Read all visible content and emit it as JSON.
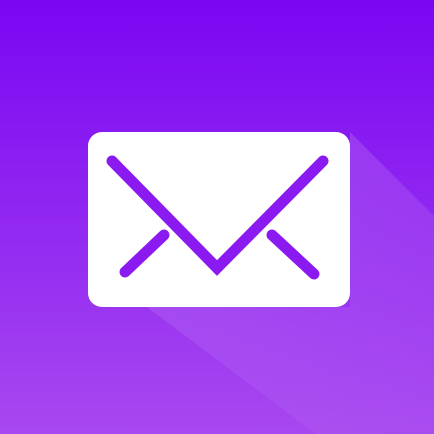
{
  "icon": {
    "name": "mail-envelope-icon",
    "colors": {
      "background_top": "#7A06F2",
      "background_bottom": "#A848F0",
      "long_shadow": "#B266F2",
      "envelope_body": "#FFFFFF",
      "envelope_lines": "#8A1AF0"
    }
  }
}
